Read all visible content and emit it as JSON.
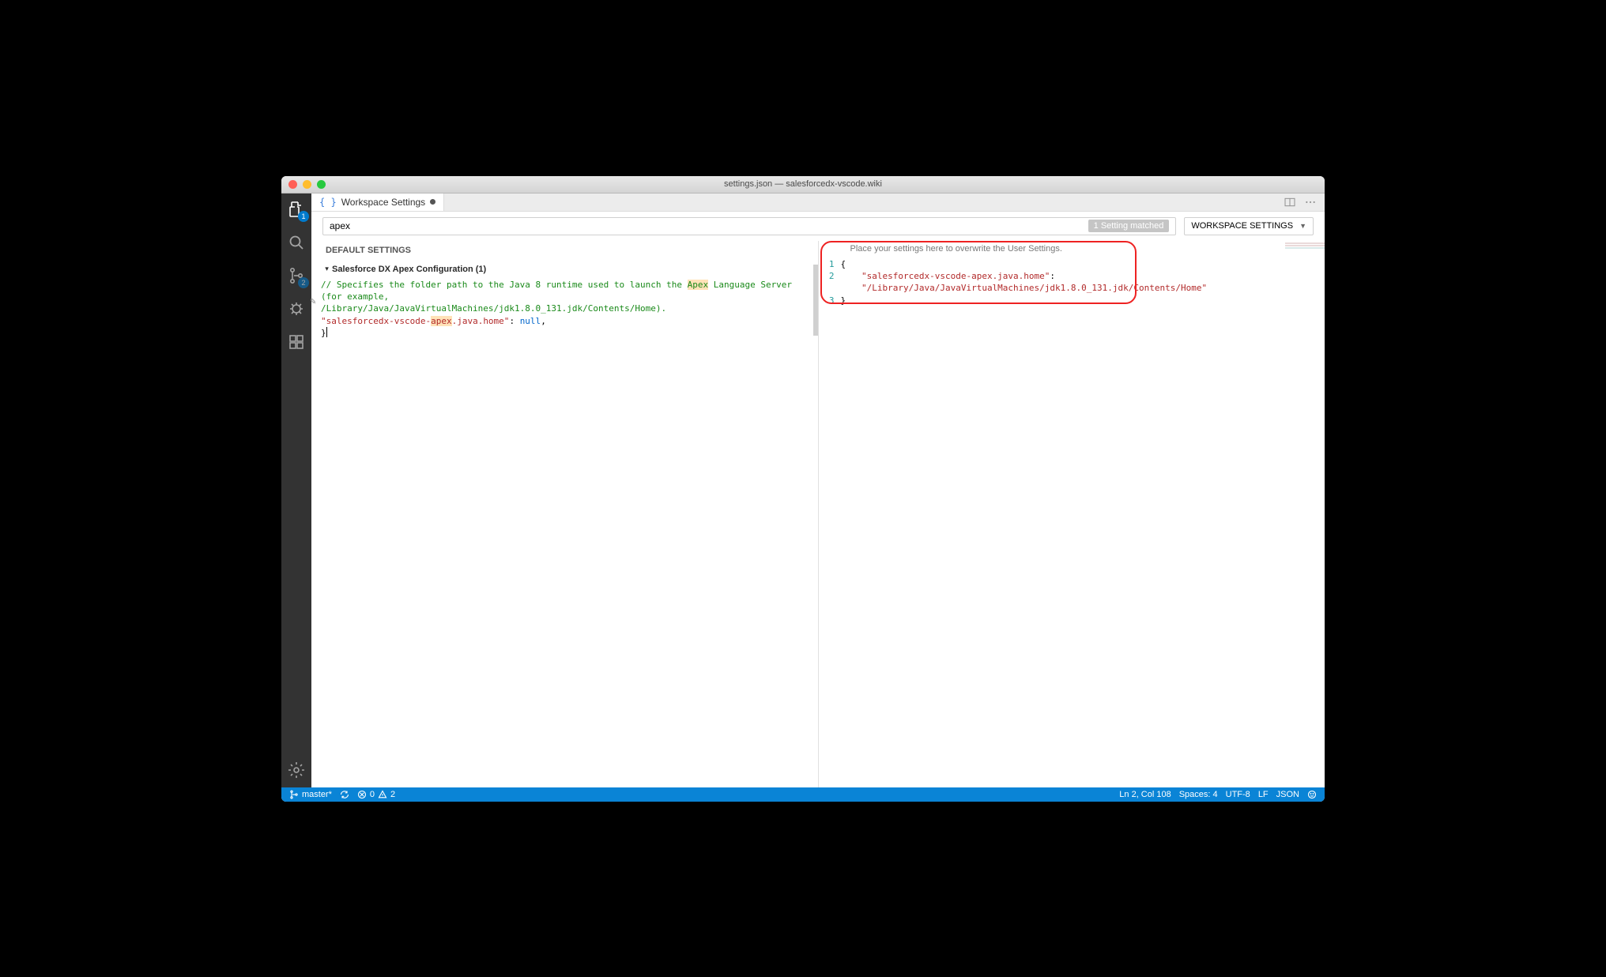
{
  "window": {
    "title": "settings.json — salesforcedx-vscode.wiki"
  },
  "activitybar": {
    "explorer_badge": "1",
    "scm_badge": "2"
  },
  "tab": {
    "label": "Workspace Settings"
  },
  "search": {
    "value": "apex",
    "match_pill": "1 Setting matched",
    "scope_label": "WORKSPACE SETTINGS"
  },
  "left": {
    "heading": "DEFAULT SETTINGS",
    "section": "Salesforce DX Apex Configuration (1)",
    "comment1": "// Specifies the folder path to the Java 8 runtime used to launch the ",
    "comment_hl": "Apex",
    "comment1b": " Language Server (for example,",
    "comment2": "/Library/Java/JavaVirtualMachines/jdk1.8.0_131.jdk/Contents/Home).",
    "key_prefix": "\"salesforcedx-vscode-",
    "key_hl": "apex",
    "key_suffix": ".java.home\"",
    "null_token": "null",
    "brace_close": "}"
  },
  "right": {
    "hint": "Place your settings here to overwrite the User Settings.",
    "line_nums": [
      "1",
      "2",
      "3"
    ],
    "l1": "{",
    "l2_key": "\"salesforcedx-vscode-apex.java.home\"",
    "l2_colon": ":",
    "l2_val": "\"/Library/Java/JavaVirtualMachines/jdk1.8.0_131.jdk/Contents/Home\"",
    "l3": "}"
  },
  "status": {
    "branch": "master*",
    "errors": "0",
    "warnings": "2",
    "pos": "Ln 2, Col 108",
    "spaces": "Spaces: 4",
    "encoding": "UTF-8",
    "eol": "LF",
    "lang": "JSON"
  }
}
